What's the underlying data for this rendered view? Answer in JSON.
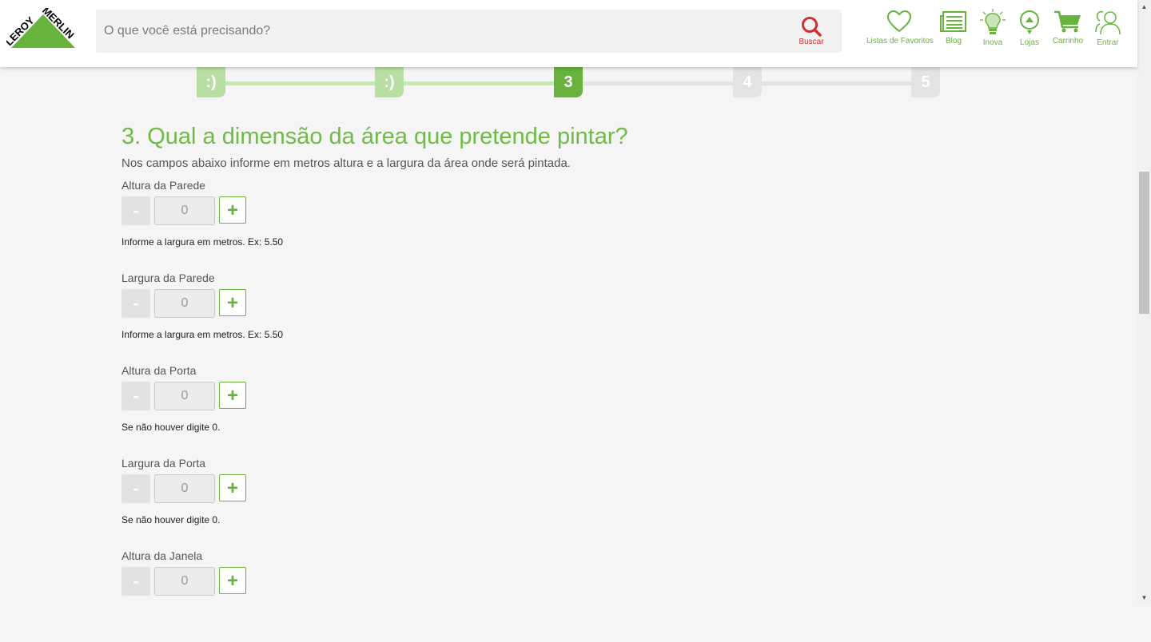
{
  "header": {
    "logo_text": "LEROY MERLIN",
    "search": {
      "placeholder": "O que você está precisando?",
      "button_label": "Buscar"
    },
    "nav": {
      "favorites": "Listas de Favoritos",
      "blog": "Blog",
      "inova": "Inova",
      "stores": "Lojas",
      "cart": "Carrinho",
      "login": "Entrar"
    }
  },
  "progress": {
    "steps": [
      {
        "label": ":)",
        "status": "done"
      },
      {
        "label": ":)",
        "status": "done"
      },
      {
        "label": "3",
        "status": "current"
      },
      {
        "label": "4",
        "status": "todo"
      },
      {
        "label": "5",
        "status": "todo"
      }
    ]
  },
  "main": {
    "title": "3. Qual a dimensão da área que pretende pintar?",
    "subtitle": "Nos campos abaixo informe em metros altura e a largura da área onde será pintada.",
    "minus_label": "-",
    "plus_label": "+",
    "fields": [
      {
        "label": "Altura da Parede",
        "value": "0",
        "hint": "Informe a largura em metros. Ex: 5.50"
      },
      {
        "label": "Largura da Parede",
        "value": "0",
        "hint": "Informe a largura em metros. Ex: 5.50"
      },
      {
        "label": "Altura da Porta",
        "value": "0",
        "hint": "Se não houver digite 0."
      },
      {
        "label": "Largura da Porta",
        "value": "0",
        "hint": "Se não houver digite 0."
      },
      {
        "label": "Altura da Janela",
        "value": "0",
        "hint": ""
      }
    ]
  },
  "colors": {
    "brand_green": "#67b33e",
    "title_green": "#6ebb45",
    "step_done": "#b9dea3",
    "step_todo": "#e3e3e3",
    "search_red": "#d32f2f"
  }
}
